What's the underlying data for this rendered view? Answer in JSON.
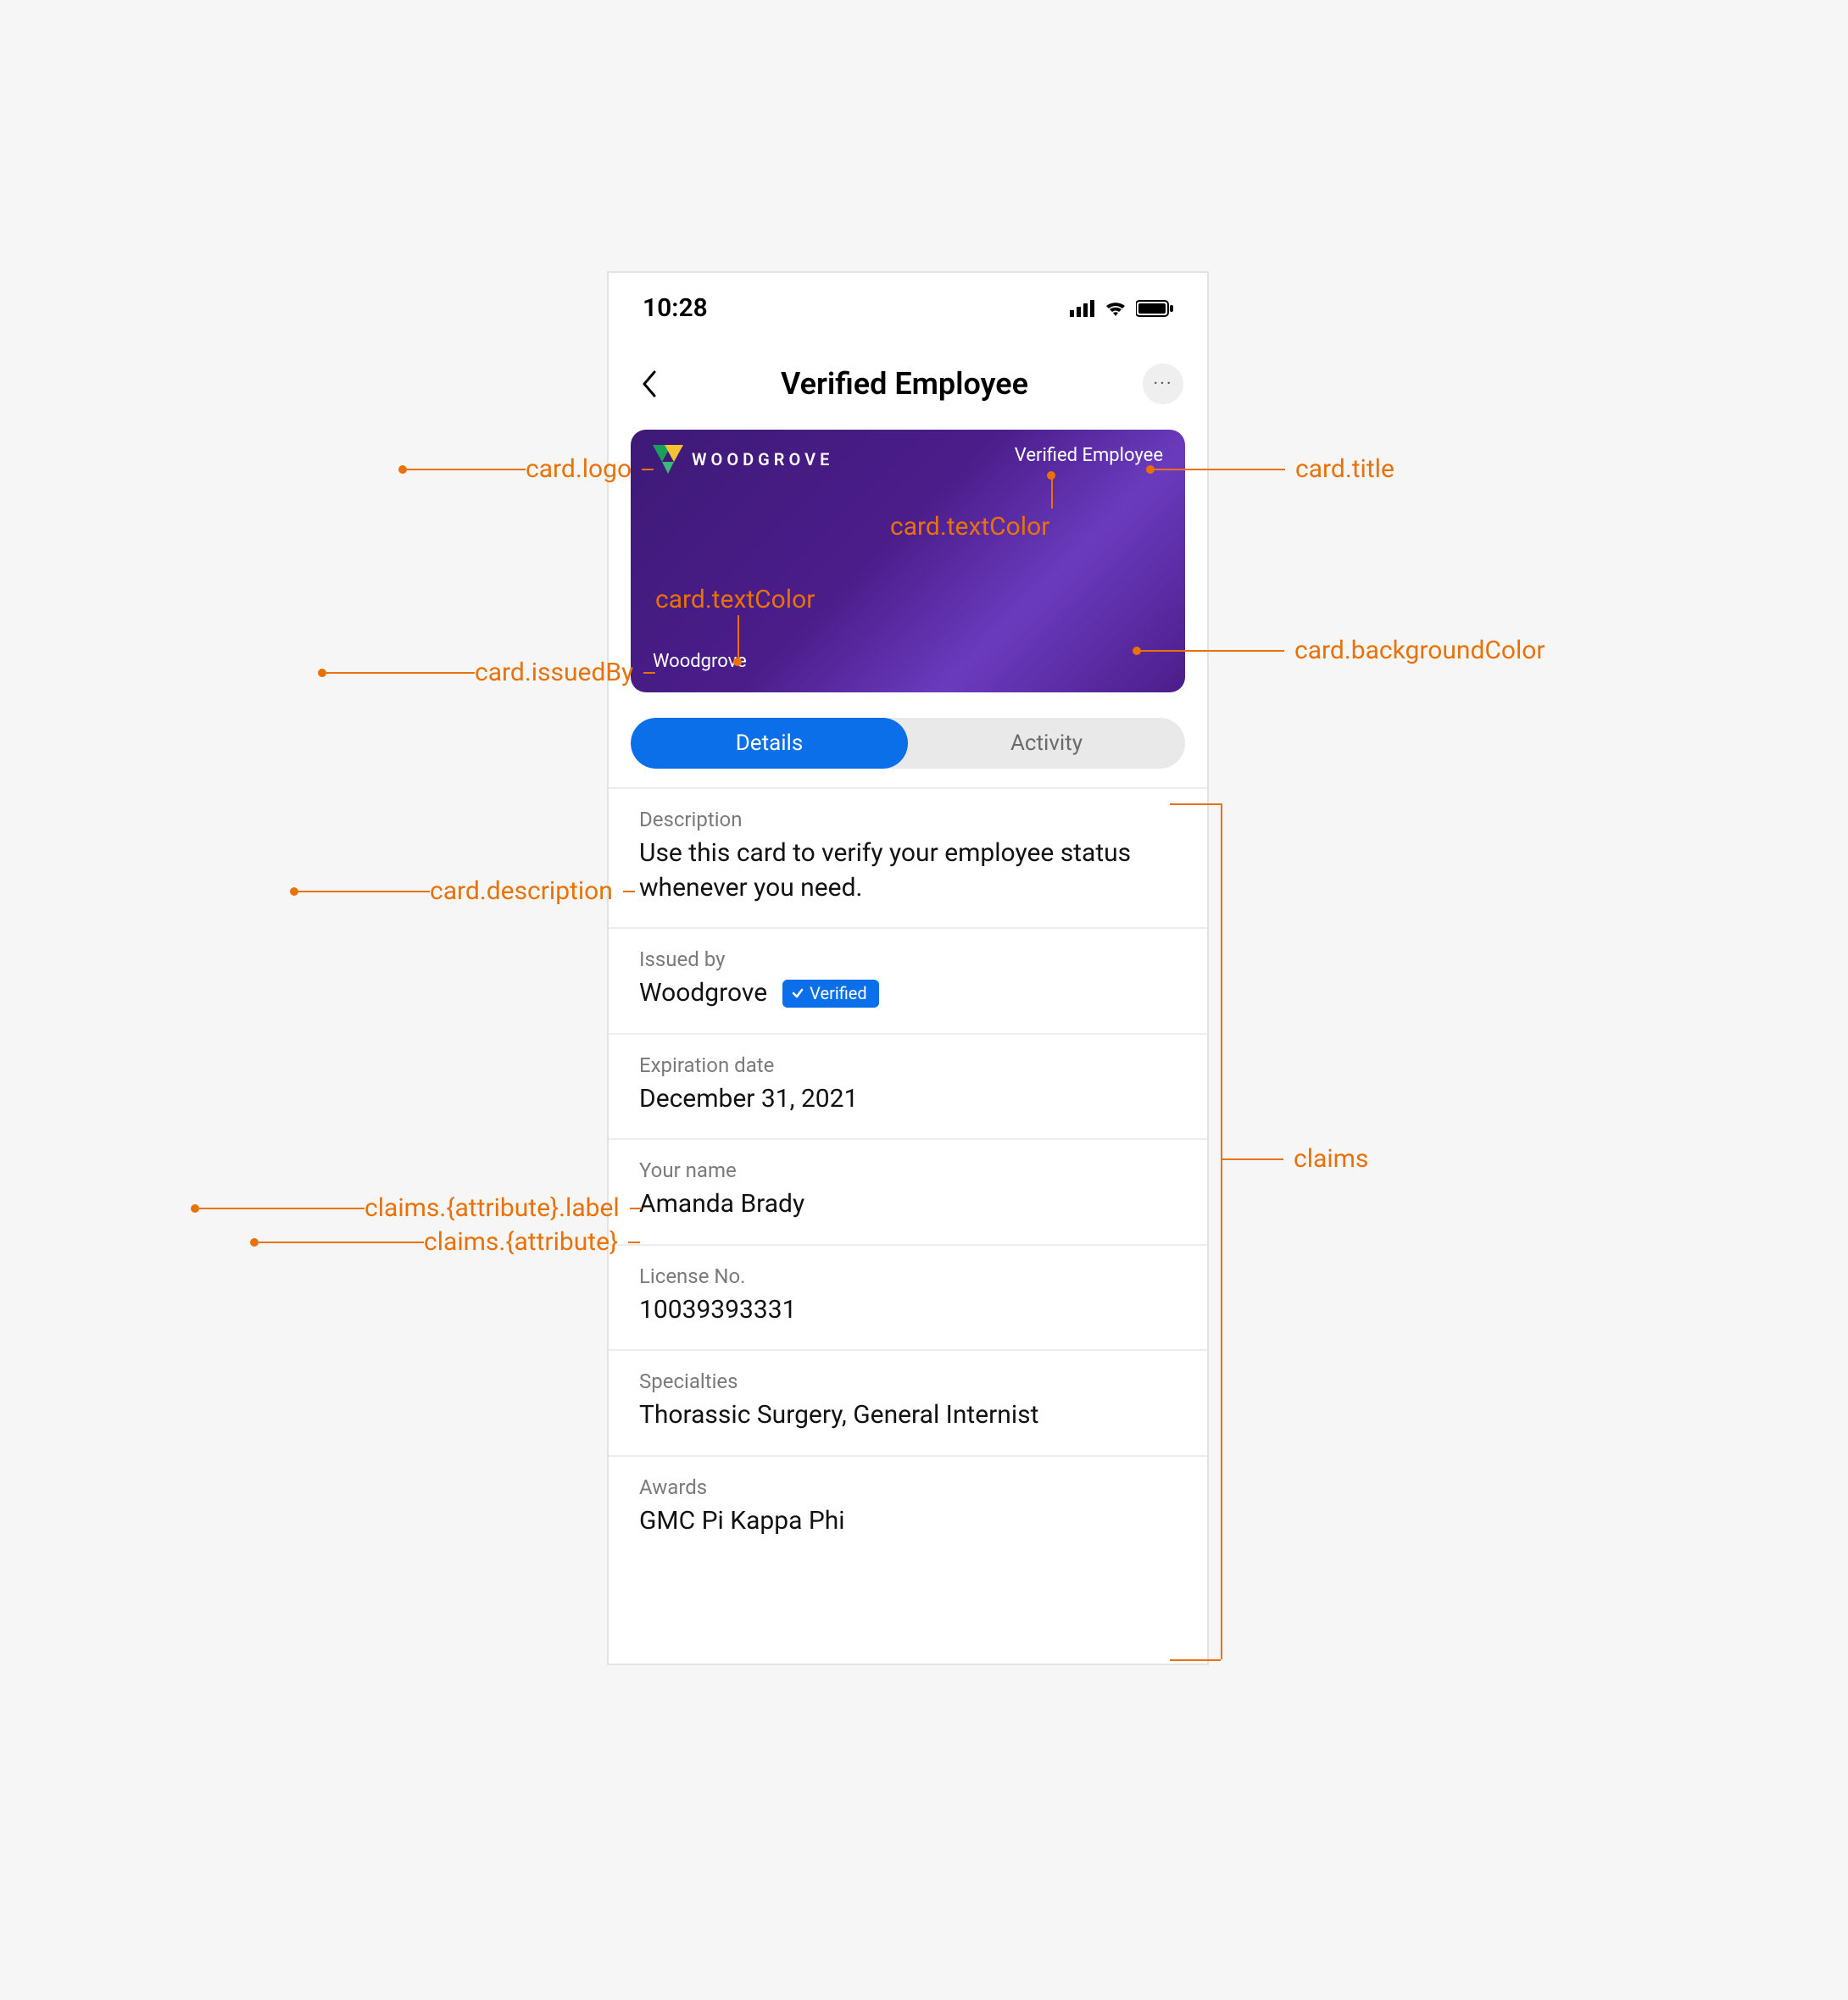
{
  "status": {
    "time": "10:28"
  },
  "nav": {
    "title": "Verified Employee",
    "more": "···"
  },
  "card": {
    "logoText": "WOODGROVE",
    "title": "Verified Employee",
    "issuer": "Woodgrove"
  },
  "tabs": {
    "details": "Details",
    "activity": "Activity"
  },
  "sections": {
    "descriptionLabel": "Description",
    "descriptionValue": "Use this card to verify your employee status whenever you need.",
    "issuedByLabel": "Issued by",
    "issuedByValue": "Woodgrove",
    "verifiedBadge": "Verified",
    "expirationLabel": "Expiration date",
    "expirationValue": "December 31, 2021",
    "nameLabel": "Your name",
    "nameValue": "Amanda Brady",
    "licenseLabel": "License No.",
    "licenseValue": "10039393331",
    "specialtiesLabel": "Specialties",
    "specialtiesValue": "Thorassic Surgery, General Internist",
    "awardsLabel": "Awards",
    "awardsValue": "GMC Pi Kappa Phi"
  },
  "annotations": {
    "cardLogo": "card.logo",
    "cardTitle": "card.title",
    "cardTextColor1": "card.textColor",
    "cardTextColor2": "card.textColor",
    "cardIssuedBy": "card.issuedBy",
    "cardBackgroundColor": "card.backgroundColor",
    "cardDescription": "card.description",
    "claimsAttrLabel": "claims.{attribute}.label",
    "claimsAttr": "claims.{attribute}",
    "claims": "claims"
  }
}
